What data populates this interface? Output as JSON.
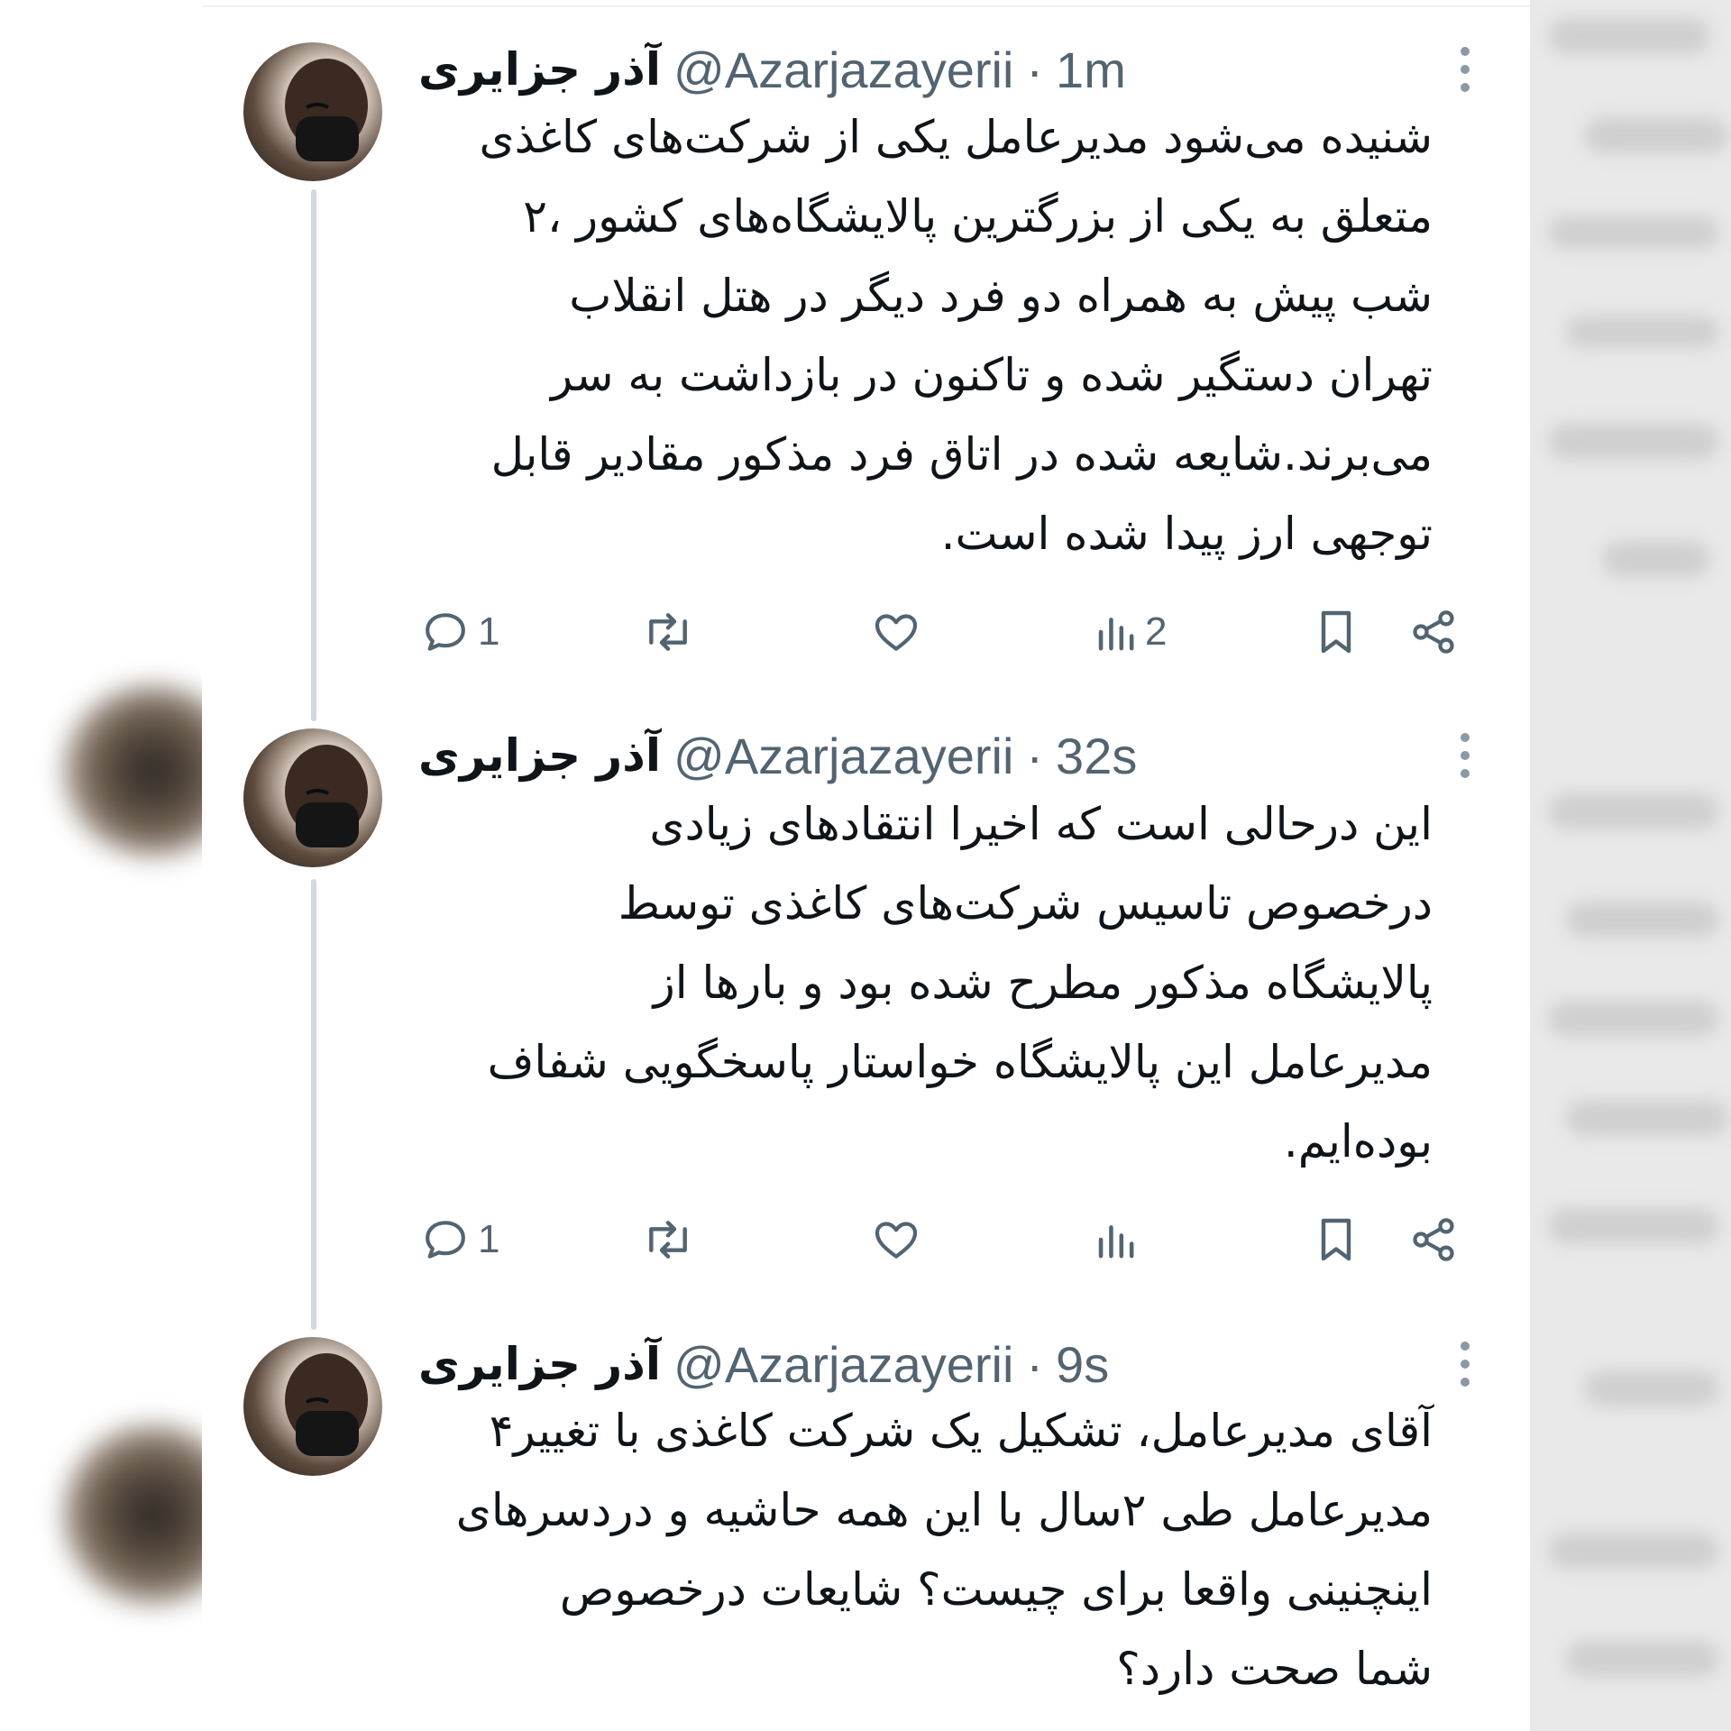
{
  "tweets": [
    {
      "display_name": "آذر جزایری",
      "handle": "@Azarjazayerii",
      "separator": "·",
      "time": "1m",
      "lines": [
        "شنیده می‌شود مدیرعامل یکی از شرکت‌های کاغذی",
        "متعلق به یکی از بزرگترین پالایشگاه‌های کشور ،۲",
        "شب پیش به همراه دو فرد دیگر در هتل انقلاب",
        "تهران دستگیر شده و تاکنون در بازداشت به سر",
        "می‌برند.شایعه شده در اتاق فرد مذکور مقادیر قابل",
        "توجهی ارز پیدا شده است."
      ],
      "reply_count": "1",
      "retweet_count": "",
      "like_count": "",
      "view_count": "2"
    },
    {
      "display_name": "آذر جزایری",
      "handle": "@Azarjazayerii",
      "separator": "·",
      "time": "32s",
      "lines": [
        "این درحالی است که اخیرا انتقادهای زیادی",
        "درخصوص تاسیس شرکت‌های کاغذی توسط",
        "پالایشگاه مذکور مطرح شده بود و بارها از",
        "مدیرعامل این پالایشگاه خواستار پاسخگویی شفاف",
        "بوده‌ایم."
      ],
      "reply_count": "1",
      "retweet_count": "",
      "like_count": "",
      "view_count": ""
    },
    {
      "display_name": "آذر جزایری",
      "handle": "@Azarjazayerii",
      "separator": "·",
      "time": "9s",
      "lines": [
        "آقای مدیرعامل، تشکیل یک شرکت کاغذی با تغییر۴",
        "مدیرعامل طی ۲سال با این همه حاشیه و دردسرهای",
        "اینچنینی واقعا برای چیست؟ شایعات درخصوص",
        "شما صحت دارد؟"
      ]
    }
  ],
  "icons": {
    "reply": "reply-icon",
    "retweet": "retweet-icon",
    "like": "like-icon",
    "views": "views-icon",
    "bookmark": "bookmark-icon",
    "share": "share-icon",
    "more": "more-icon"
  },
  "colors": {
    "text": "#0f1419",
    "secondary": "#536471",
    "thread_line": "#cfd9de"
  }
}
